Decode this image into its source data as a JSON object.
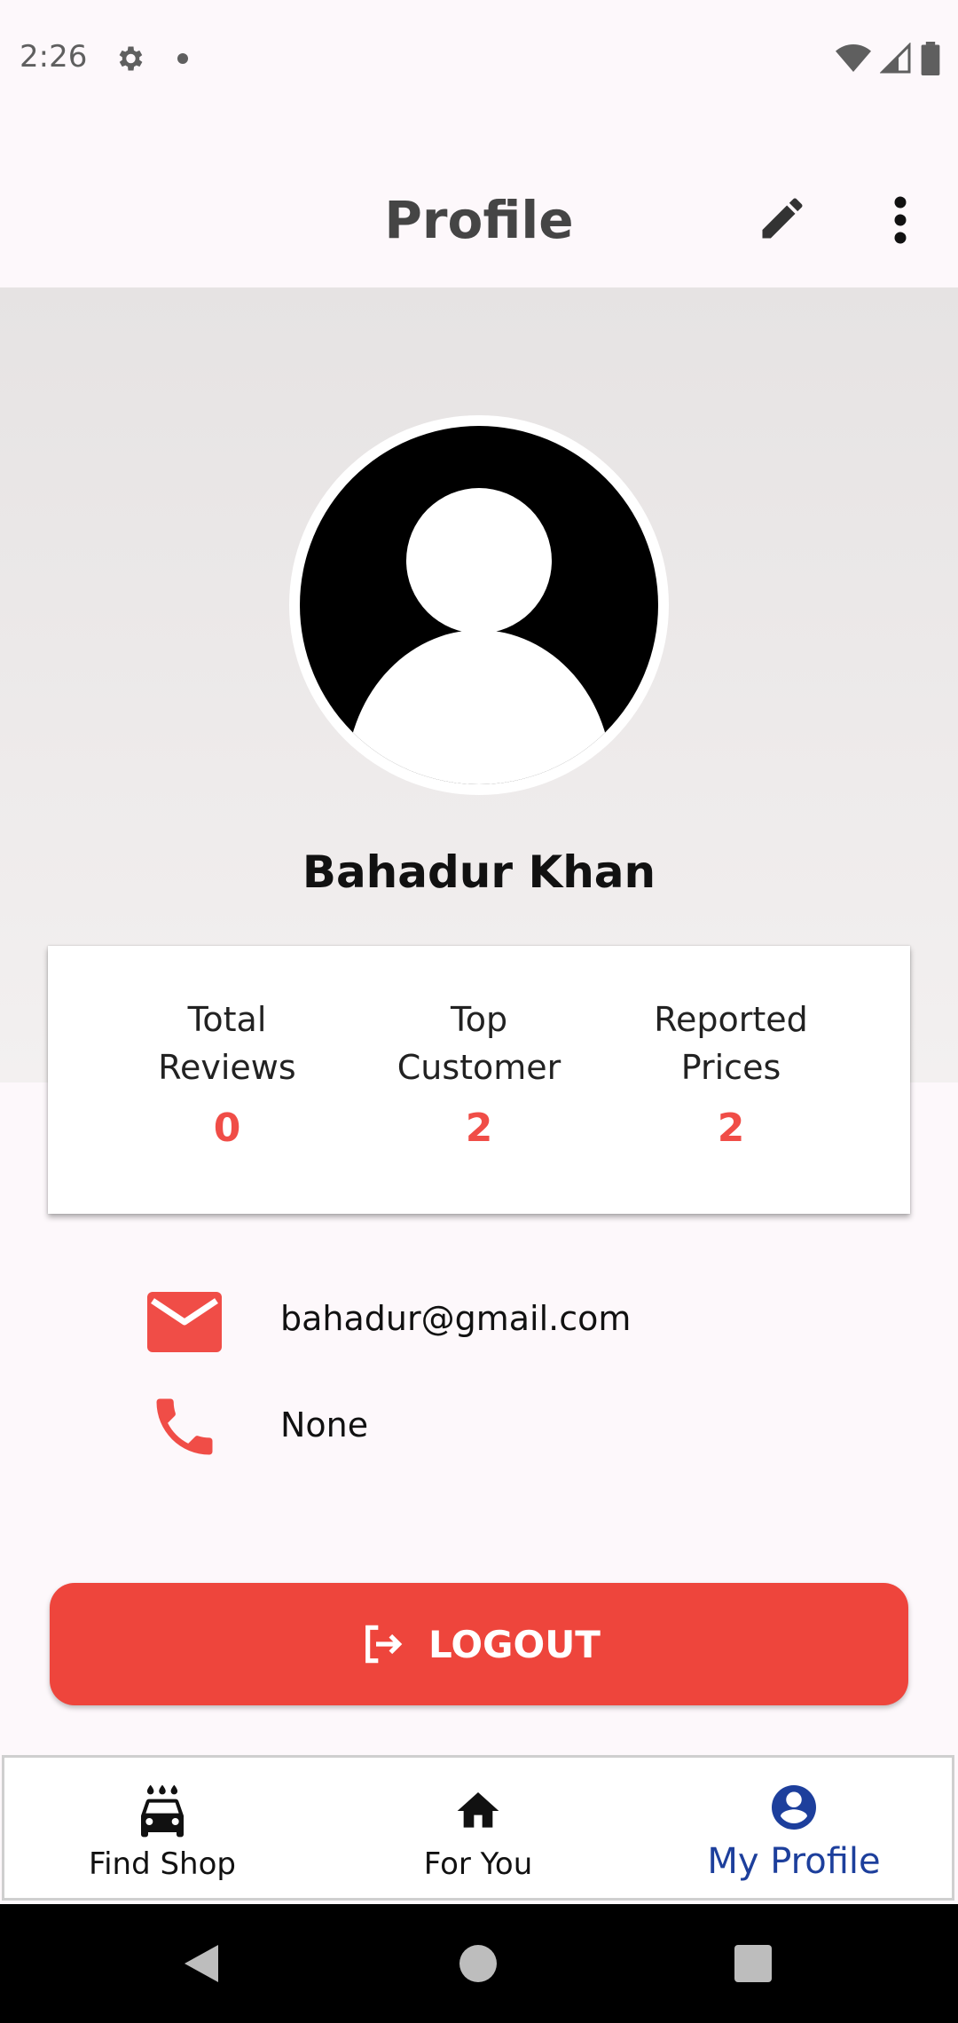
{
  "status_bar": {
    "time": "2:26"
  },
  "app_bar": {
    "title": "Profile"
  },
  "profile": {
    "name": "Bahadur Khan"
  },
  "stats": [
    {
      "label": "Total\nReviews",
      "value": "0"
    },
    {
      "label": "Top\nCustomer",
      "value": "2"
    },
    {
      "label": "Reported\nPrices",
      "value": "2"
    }
  ],
  "contact": {
    "email": "bahadur@gmail.com",
    "phone": "None"
  },
  "logout": {
    "label": "LOGOUT"
  },
  "bottom_nav": [
    {
      "label": "Find Shop",
      "icon": "car-wash-icon",
      "active": false
    },
    {
      "label": "For You",
      "icon": "home-icon",
      "active": false
    },
    {
      "label": "My Profile",
      "icon": "account-circle-icon",
      "active": true
    }
  ],
  "colors": {
    "accent_red": "#ee453c",
    "stat_red": "#f04d47",
    "active_nav": "#1d3f9c"
  }
}
